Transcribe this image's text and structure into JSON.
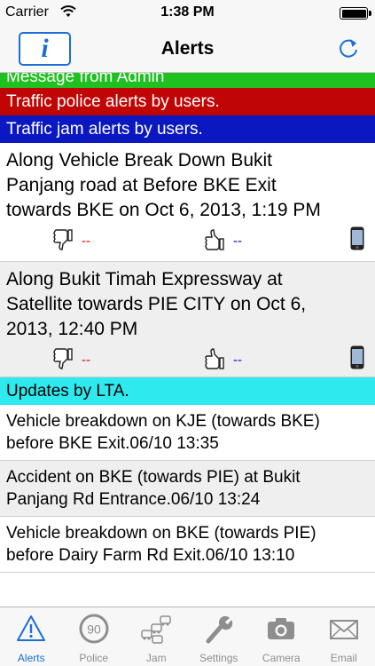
{
  "status_bar": {
    "carrier": "Carrier",
    "time": "1:38 PM"
  },
  "nav": {
    "title": "Alerts",
    "info_label": "i"
  },
  "banners": {
    "admin": "Message from Admin",
    "police": "Traffic police alerts by users.",
    "jam": "Traffic jam alerts by users.",
    "lta": "Updates by LTA."
  },
  "user_alerts": [
    {
      "text": "Along Vehicle Break Down Bukit\nPanjang road  at Before BKE Exit\ntowards BKE  on Oct 6, 2013, 1:19 PM",
      "dislikes": "--",
      "likes": "--"
    },
    {
      "text": "Along Bukit Timah Expressway at\nSatellite towards PIE CITY on Oct 6,\n2013, 12:40 PM",
      "dislikes": "--",
      "likes": "--"
    }
  ],
  "lta_updates": [
    {
      "line1": "Vehicle breakdown on KJE (towards BKE)",
      "line2": "before BKE Exit.06/10 13:35"
    },
    {
      "line1": "Accident on BKE (towards PIE) at Bukit",
      "line2": "Panjang Rd Entrance.06/10 13:24"
    },
    {
      "line1": "Vehicle breakdown on BKE (towards PIE)",
      "line2": "before Dairy Farm Rd Exit.06/10 13:10"
    }
  ],
  "tabs": [
    {
      "label": "Alerts",
      "icon": "warning-triangle-icon",
      "active": true
    },
    {
      "label": "Police",
      "icon": "speed-limit-icon"
    },
    {
      "label": "Jam",
      "icon": "traffic-jam-icon"
    },
    {
      "label": "Settings",
      "icon": "wrench-icon"
    },
    {
      "label": "Camera",
      "icon": "camera-icon"
    },
    {
      "label": "Email",
      "icon": "envelope-icon"
    }
  ],
  "speed_limit_value": "90",
  "colors": {
    "accent": "#1a6ed8",
    "admin_banner": "#1fc121",
    "police_banner": "#c00505",
    "jam_banner": "#0b18c2",
    "lta_banner": "#2ee9ee"
  }
}
